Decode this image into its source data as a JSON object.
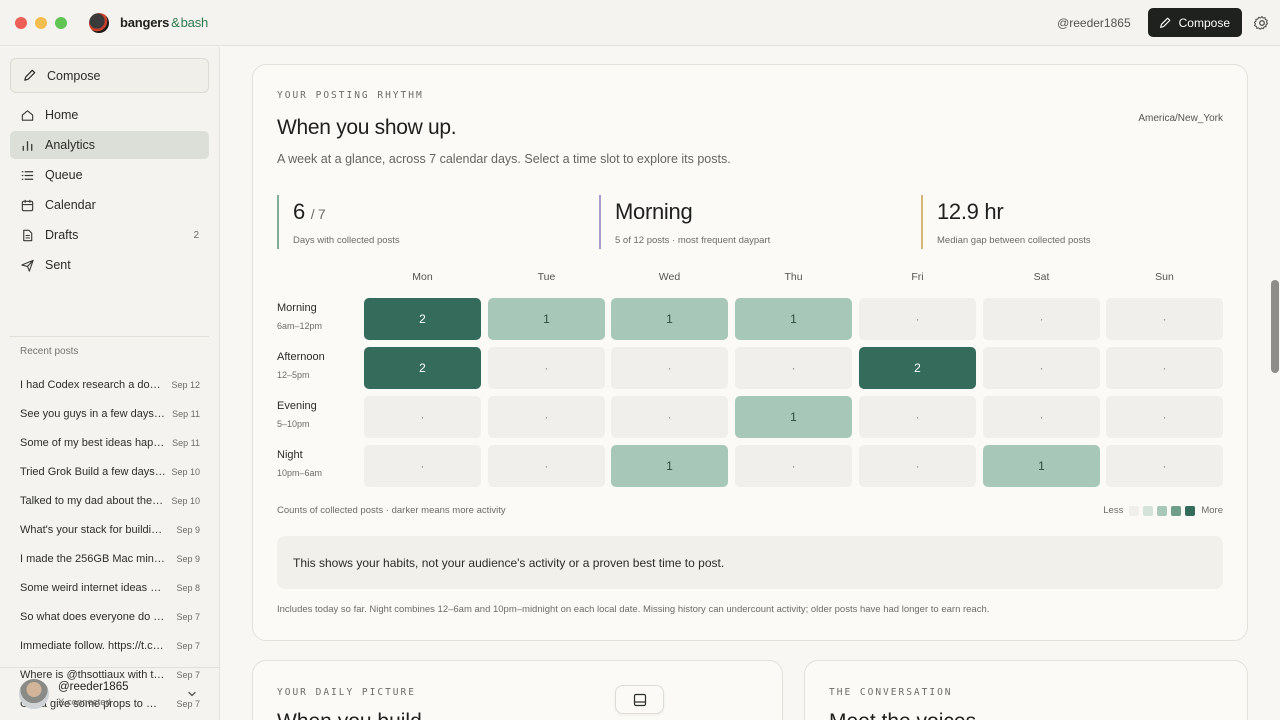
{
  "app": {
    "brand_main": "bangers",
    "brand_amp": "&",
    "brand_accent": "bash",
    "user_handle": "@reeder1865",
    "compose_label": "Compose"
  },
  "sidebar": {
    "compose_label": "Compose",
    "nav": [
      {
        "label": "Home",
        "icon": "home-icon"
      },
      {
        "label": "Analytics",
        "icon": "bar-chart-icon",
        "active": true
      },
      {
        "label": "Queue",
        "icon": "list-icon"
      },
      {
        "label": "Calendar",
        "icon": "calendar-icon"
      },
      {
        "label": "Drafts",
        "icon": "document-icon",
        "count": "2"
      },
      {
        "label": "Sent",
        "icon": "send-icon"
      }
    ],
    "recent_label": "Recent posts",
    "recent": [
      {
        "text": "I had Codex research a dom…",
        "date": "Sep 12"
      },
      {
        "text": "See you guys in a few days. …",
        "date": "Sep 11"
      },
      {
        "text": "Some of my best ideas hap…",
        "date": "Sep 11"
      },
      {
        "text": "Tried Grok Build a few days …",
        "date": "Sep 10"
      },
      {
        "text": "Talked to my dad about the …",
        "date": "Sep 10"
      },
      {
        "text": "What's your stack for buildin…",
        "date": "Sep 9"
      },
      {
        "text": "I made the 256GB Mac mini …",
        "date": "Sep 9"
      },
      {
        "text": "Some weird internet ideas ar…",
        "date": "Sep 8"
      },
      {
        "text": "So what does everyone do …",
        "date": "Sep 7"
      },
      {
        "text": "Immediate follow. https://t.c…",
        "date": "Sep 7"
      },
      {
        "text": "Where is @thsottiaux with t…",
        "date": "Sep 7"
      },
      {
        "text": "Gotta give some props to @…",
        "date": "Sep 7"
      }
    ],
    "user": {
      "name": "@reeder1865",
      "status": "X connected"
    }
  },
  "rhythm": {
    "eyebrow": "YOUR POSTING RHYTHM",
    "title": "When you show up.",
    "timezone": "America/New_York",
    "subtitle": "A week at a glance, across 7 calendar days. Select a time slot to explore its posts.",
    "stats": [
      {
        "value": "6",
        "suffix": "/ 7",
        "label": "Days with collected posts",
        "color": "#7fae98"
      },
      {
        "value": "Morning",
        "suffix": "",
        "label": "5 of 12 posts · most frequent daypart",
        "color": "#a99ac9"
      },
      {
        "value": "12.9 hr",
        "suffix": "",
        "label": "Median gap between collected posts",
        "color": "#d4b57a"
      }
    ],
    "days": [
      "Mon",
      "Tue",
      "Wed",
      "Thu",
      "Fri",
      "Sat",
      "Sun"
    ],
    "slots": [
      {
        "label": "Morning",
        "range": "6am–12pm",
        "counts": [
          2,
          1,
          1,
          1,
          0,
          0,
          0
        ]
      },
      {
        "label": "Afternoon",
        "range": "12–5pm",
        "counts": [
          2,
          0,
          0,
          0,
          2,
          0,
          0
        ]
      },
      {
        "label": "Evening",
        "range": "5–10pm",
        "counts": [
          0,
          0,
          0,
          1,
          0,
          0,
          0
        ]
      },
      {
        "label": "Night",
        "range": "10pm–6am",
        "counts": [
          0,
          0,
          1,
          0,
          0,
          1,
          0
        ]
      }
    ],
    "empty_marker": "·",
    "caption": "Counts of collected posts · darker means more activity",
    "legend_less": "Less",
    "legend_more": "More",
    "legend_colors": [
      "#f0efeb",
      "#d3e3da",
      "#a7c8b8",
      "#6f9f8a",
      "#346b5b"
    ],
    "note": "This shows your habits, not your audience's activity or a proven best time to post.",
    "footnote": "Includes today so far. Night combines 12–6am and 10pm–midnight on each local date. Missing history can undercount activity; older posts have had longer to earn reach."
  },
  "daily": {
    "eyebrow": "YOUR DAILY PICTURE",
    "title": "When you build"
  },
  "conversation": {
    "eyebrow": "THE CONVERSATION",
    "title": "Meet the voices"
  }
}
